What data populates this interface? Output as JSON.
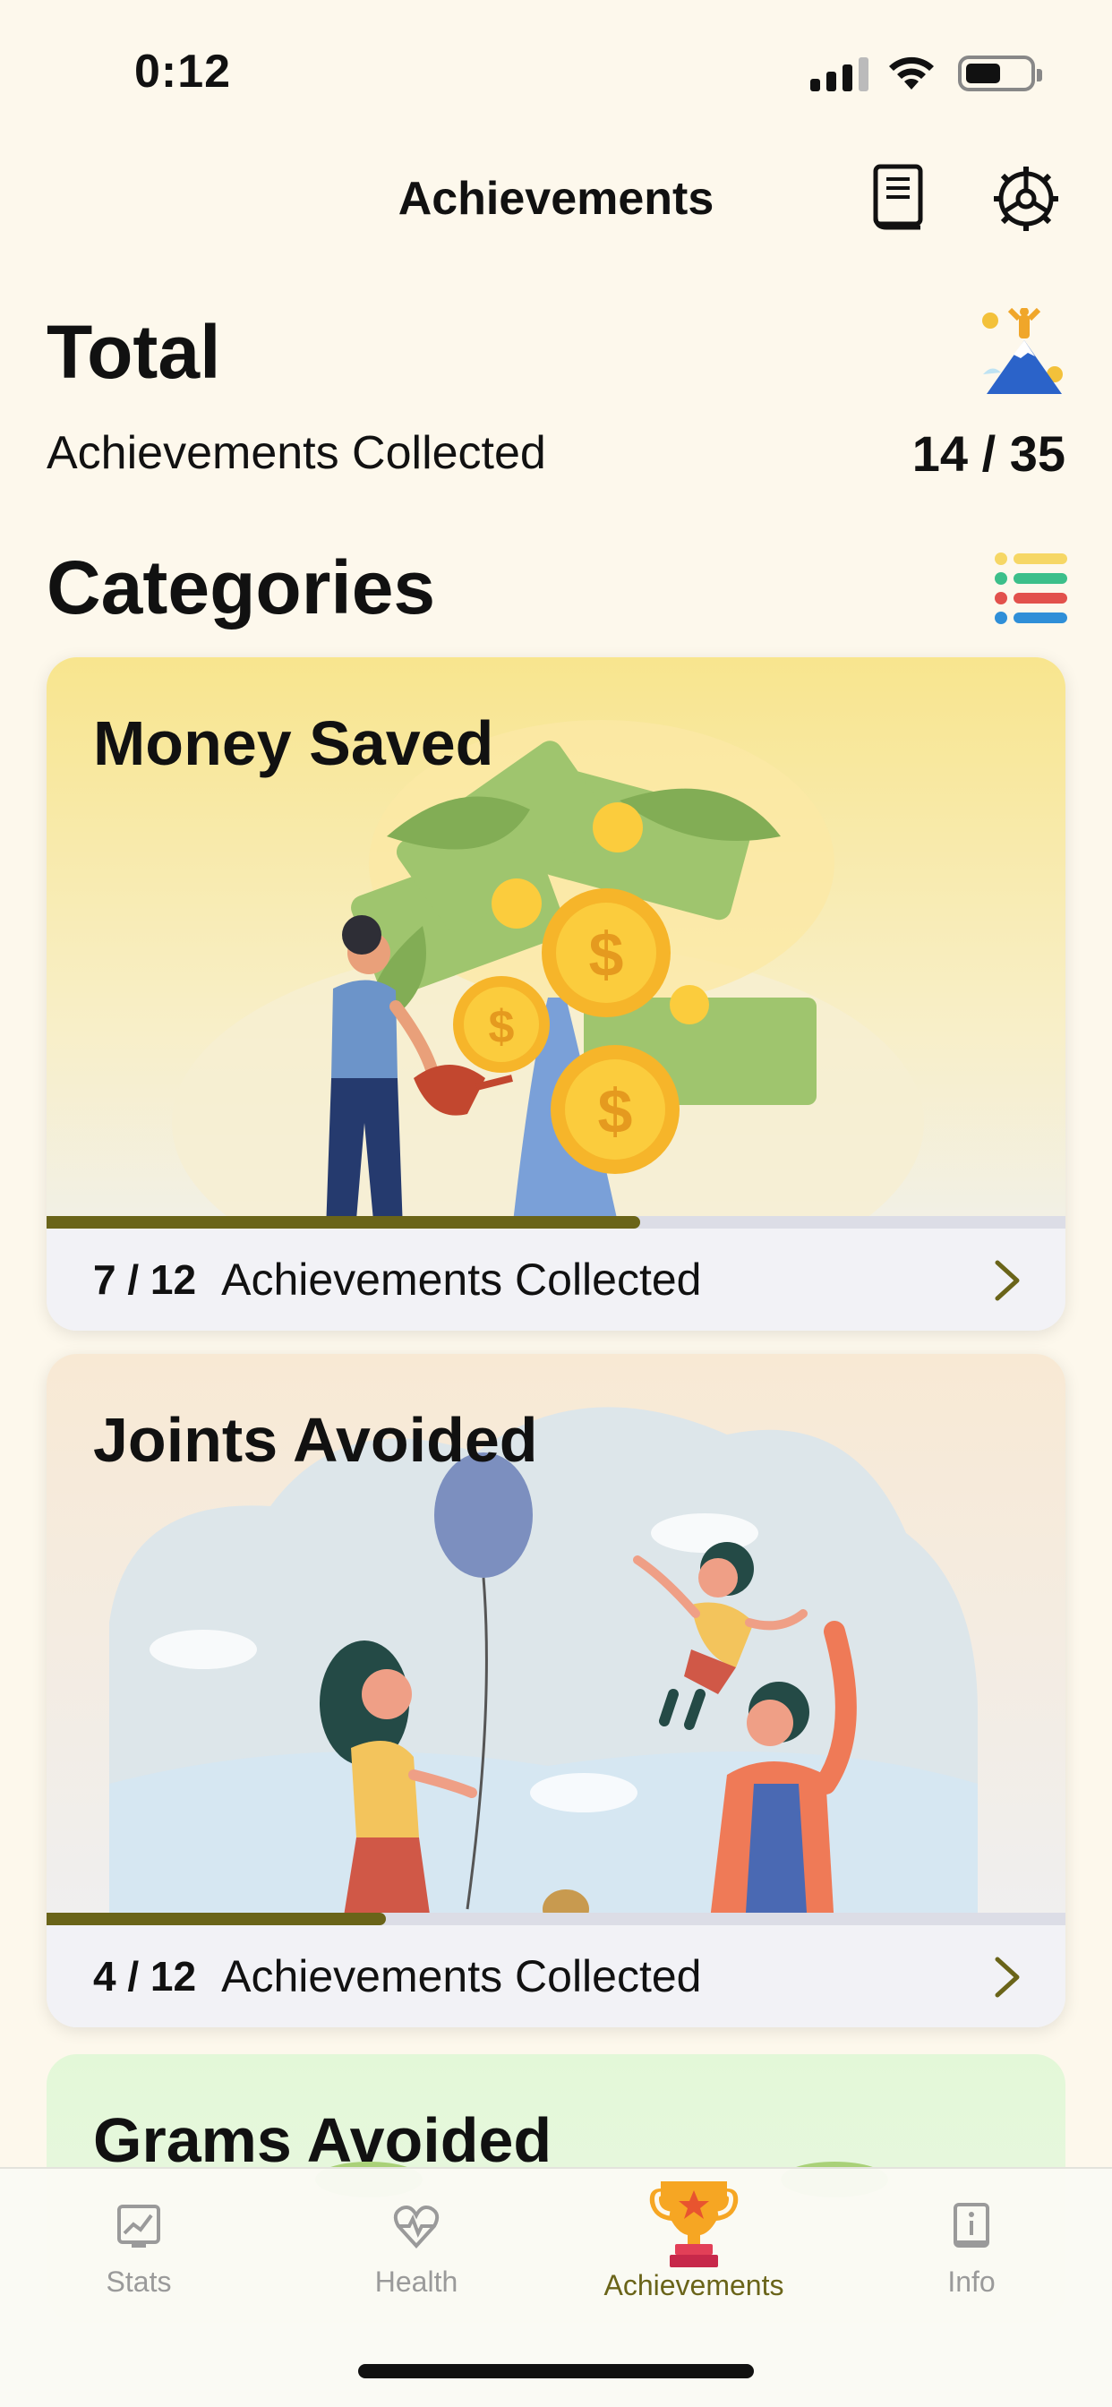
{
  "status_bar": {
    "time": "0:12"
  },
  "nav": {
    "title": "Achievements"
  },
  "total": {
    "title": "Total",
    "subtitle": "Achievements Collected",
    "count": "14 / 35"
  },
  "categories": {
    "title": "Categories",
    "cards": [
      {
        "title": "Money Saved",
        "count": "7 / 12",
        "label": "Achievements Collected",
        "progress": 0.583
      },
      {
        "title": "Joints Avoided",
        "count": "4 / 12",
        "label": "Achievements Collected",
        "progress": 0.333
      },
      {
        "title": "Grams Avoided"
      }
    ]
  },
  "tabs": [
    {
      "label": "Stats",
      "icon": "stats-icon",
      "active": false
    },
    {
      "label": "Health",
      "icon": "heart-pulse-icon",
      "active": false
    },
    {
      "label": "Achievements",
      "icon": "trophy-icon",
      "active": true
    },
    {
      "label": "Info",
      "icon": "info-book-icon",
      "active": false
    }
  ],
  "colors": {
    "background": "#fdf8ec",
    "accent": "#6a6419",
    "tab_inactive": "#9a9a9a"
  }
}
